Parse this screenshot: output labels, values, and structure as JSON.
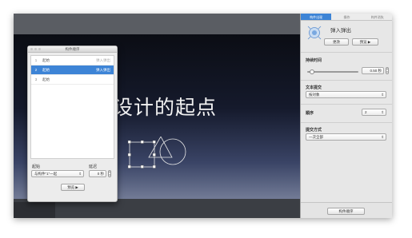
{
  "slide": {
    "title": "设计的起点"
  },
  "order_panel": {
    "title": "构件顺序",
    "rows": [
      {
        "num": "1",
        "name": "起始",
        "effect": "弹入弹出"
      },
      {
        "num": "2",
        "name": "起始",
        "effect": "弹入弹出"
      },
      {
        "num": "3",
        "name": "起始",
        "effect": ""
      }
    ],
    "start_label": "起始",
    "start_value": "与构件\"1\"一起",
    "delay_label": "延迟",
    "delay_value": "0 秒",
    "preview_label": "预览 ▶"
  },
  "inspector": {
    "tabs": [
      "构件出现",
      "操作",
      "构件消失"
    ],
    "effect_name": "弹入弹出",
    "change_label": "更改",
    "preview_label": "预览 ▶",
    "duration_label": "持续时间",
    "duration_value": "0.50 秒",
    "duration_fraction": 0.05,
    "text_delivery_label": "文本提交",
    "text_delivery_value": "按对象",
    "order_label": "顺序",
    "order_value": "2",
    "delivery_label": "提交方式",
    "delivery_value": "一次全部",
    "build_order_label": "构件顺序"
  },
  "colors": {
    "accent": "#3d84d6"
  }
}
